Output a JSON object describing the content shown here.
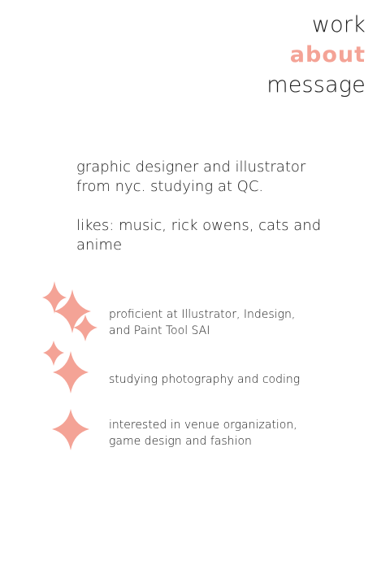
{
  "nav": {
    "items": [
      {
        "label": "work"
      },
      {
        "label": "about"
      },
      {
        "label": "message"
      }
    ]
  },
  "bio": {
    "intro": "graphic designer and illustrator from nyc. studying at QC.",
    "likes": "likes: music, rick owens, cats and anime"
  },
  "skills": {
    "items": [
      {
        "text": "proficient at Illustrator, Indesign, and Paint Tool SAI"
      },
      {
        "text": "studying photography and coding"
      },
      {
        "text": "interested in venue organization, game design and fashion"
      }
    ]
  },
  "colors": {
    "accent": "#f4a396",
    "text": "#1a1a1a",
    "background": "#ffffff"
  }
}
